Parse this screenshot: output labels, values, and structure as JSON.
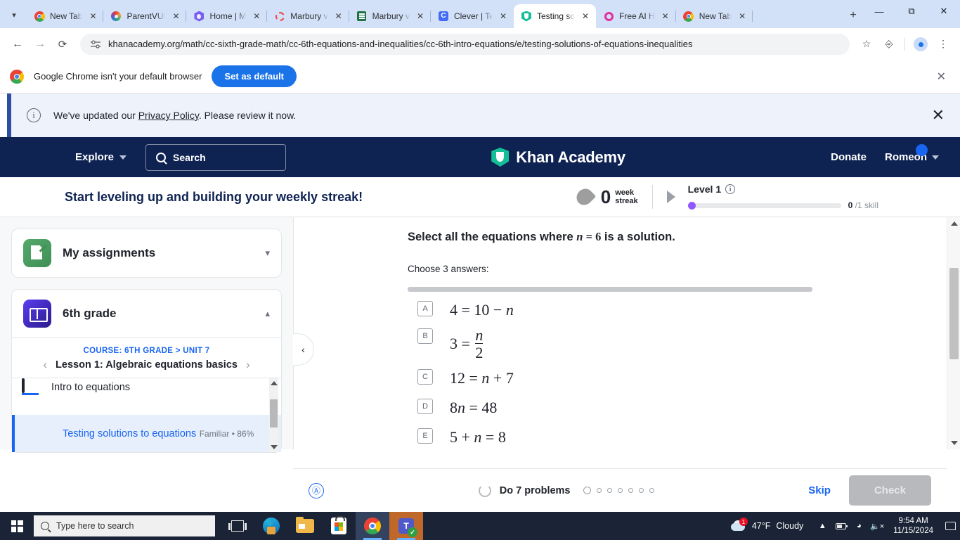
{
  "browser": {
    "tab_list_icon": "chevron-down-icon",
    "tabs": [
      {
        "title": "New Tab",
        "favicon": "chrome-icon",
        "active": false
      },
      {
        "title": "ParentVUE",
        "favicon": "parentvue-icon",
        "active": false
      },
      {
        "title": "Home | M",
        "favicon": "hex-icon",
        "active": false
      },
      {
        "title": "Marbury v",
        "favicon": "ring-icon",
        "active": false
      },
      {
        "title": "Marbury v",
        "favicon": "forms-icon",
        "active": false
      },
      {
        "title": "Clever | Te",
        "favicon": "clever-icon",
        "active": false
      },
      {
        "title": "Testing so",
        "favicon": "khan-icon",
        "active": true
      },
      {
        "title": "Free AI H",
        "favicon": "ring2-icon",
        "active": false
      },
      {
        "title": "New Tab",
        "favicon": "chrome-icon",
        "active": false
      }
    ],
    "new_tab_label": "+",
    "window_controls": {
      "minimize": "—",
      "maximize": "❐",
      "close": "✕"
    },
    "url": "khanacademy.org/math/cc-sixth-grade-math/cc-6th-equations-and-inequalities/cc-6th-intro-equations/e/testing-solutions-of-equations-inequalities",
    "back_icon": "back-arrow-icon",
    "forward_icon": "forward-arrow-icon",
    "reload_icon": "reload-icon",
    "site_settings_icon": "tune-icon",
    "bookmark_icon": "star-icon",
    "extensions_icon": "extensions-icon",
    "profile_icon": "profile-avatar-icon",
    "menu_icon": "three-dot-menu-icon"
  },
  "default_browser_bar": {
    "message": "Google Chrome isn't your default browser",
    "button_label": "Set as default",
    "close_icon": "close-icon"
  },
  "privacy_banner": {
    "text_before": "We've updated our ",
    "link_text": "Privacy Policy",
    "text_after": ". Please review it now.",
    "info_icon": "info-icon",
    "close_icon": "close-icon"
  },
  "khan_nav": {
    "explore_label": "Explore",
    "search_placeholder": "Search",
    "brand": "Khan Academy",
    "donate_label": "Donate",
    "user_label": "Romeoh"
  },
  "streak_bar": {
    "title": "Start leveling up and building your weekly streak!",
    "streak_count": "0",
    "streak_unit_line1": "week",
    "streak_unit_line2": "streak",
    "level_label": "Level 1",
    "level_info_icon": "info-icon",
    "skill_count": "0",
    "skill_total": "/1 skill",
    "progress_percent": 0
  },
  "sidebar": {
    "assignments": {
      "title": "My assignments",
      "icon": "assignments-icon",
      "chevron": "chevron-down-icon"
    },
    "grade": {
      "title": "6th grade",
      "icon": "book-icon",
      "chevron": "chevron-up-icon"
    },
    "breadcrumb_course": "COURSE: 6TH GRADE > UNIT 7",
    "lesson_title": "Lesson 1: Algebraic equations basics",
    "prev_icon": "chevron-left-icon",
    "next_icon": "chevron-right-icon",
    "lessons": [
      {
        "title": "Intro to equations",
        "meta": "",
        "icon": "article-icon",
        "active": false
      },
      {
        "title": "Testing solutions to equations",
        "meta": "Familiar • 86%",
        "icon": "exercise-icon",
        "active": true
      }
    ]
  },
  "exercise": {
    "collapse_icon": "chevron-left-icon",
    "prompt_pre": "Select all the equations where ",
    "prompt_math_var": "n",
    "prompt_math_eq": " = ",
    "prompt_math_val": "6",
    "prompt_post": " is a solution.",
    "instruction": "Choose 3 answers:",
    "choices": [
      {
        "letter": "A",
        "equation": "4 = 10 − n",
        "type": "plain"
      },
      {
        "letter": "B",
        "equation": "3 = n/2",
        "type": "fraction",
        "lhs": "3 =",
        "num": "n",
        "den": "2"
      },
      {
        "letter": "C",
        "equation": "12 = n + 7",
        "type": "plain"
      },
      {
        "letter": "D",
        "equation": "8n = 48",
        "type": "plain"
      },
      {
        "letter": "E",
        "equation": "5 + n = 8",
        "type": "plain"
      }
    ],
    "footer": {
      "accessibility_icon": "accessibility-icon",
      "refresh_icon": "refresh-icon",
      "problems_label": "Do 7 problems",
      "dots_total": 7,
      "skip_label": "Skip",
      "check_label": "Check"
    }
  },
  "taskbar": {
    "start_icon": "windows-start-icon",
    "search_placeholder": "Type here to search",
    "search_icon": "search-icon",
    "items": [
      {
        "name": "task-view-icon"
      },
      {
        "name": "edge-icon"
      },
      {
        "name": "file-explorer-icon"
      },
      {
        "name": "microsoft-store-icon"
      },
      {
        "name": "chrome-icon"
      },
      {
        "name": "teams-icon"
      }
    ],
    "weather_temp": "47°F",
    "weather_desc": "Cloudy",
    "weather_badge": "1",
    "tray_expand_icon": "chevron-up-icon",
    "battery_icon": "battery-icon",
    "network_icon": "wifi-icon",
    "volume_icon": "volume-muted-icon",
    "time": "9:54 AM",
    "date": "11/15/2024",
    "notification_icon": "notification-icon"
  },
  "colors": {
    "khan_navy": "#0f2353",
    "khan_green": "#14bf96",
    "link_blue": "#1865f2",
    "chrome_blue": "#1a73e8",
    "purple": "#9059ff",
    "orange": "#d97706"
  }
}
